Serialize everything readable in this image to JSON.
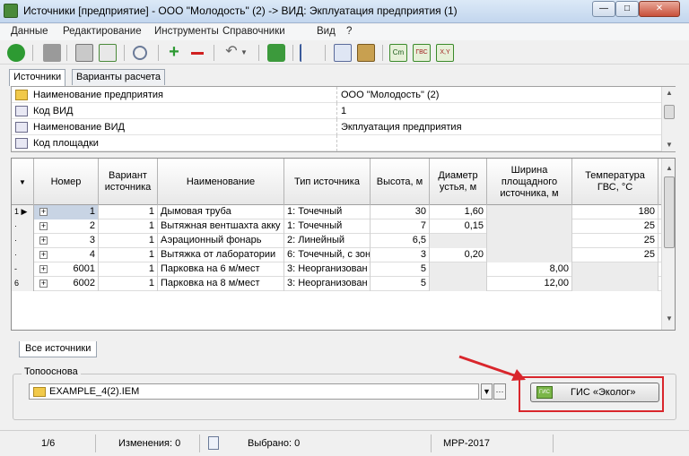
{
  "window": {
    "title": "Источники [предприятие] - ООО \"Молодость\" (2) -> ВИД: Экплуатация предприятия (1)"
  },
  "menu": [
    "Данные",
    "Редактирование",
    "Инструменты",
    "Справочники",
    "Вид",
    "?"
  ],
  "toolbar": {
    "items": [
      "back-icon",
      "save-icon",
      "print-icon",
      "export-icon",
      "search-icon",
      "add-icon",
      "remove-icon",
      "undo-icon",
      "refresh-icon",
      "tree-icon",
      "copy-icon",
      "paste-icon",
      "cm-icon",
      "gvs-icon",
      "xy-icon"
    ],
    "badges": {
      "cm": "Cm",
      "gvs": "ГВС",
      "xy": "X,Y"
    }
  },
  "tabs_top": [
    "Источники",
    "Варианты расчета"
  ],
  "properties": [
    {
      "name": "Наименование предприятия",
      "value": "ООО \"Молодость\" (2)",
      "icon": "folder-icon"
    },
    {
      "name": "Код ВИД",
      "value": "1",
      "icon": "field-icon"
    },
    {
      "name": "Наименование ВИД",
      "value": "Экплуатация предприятия",
      "icon": "field-icon"
    },
    {
      "name": "Код площадки",
      "value": "",
      "icon": "field-icon"
    }
  ],
  "grid": {
    "columns": [
      "Номер",
      "Вариант источника",
      "Наименование",
      "Тип источника",
      "Высота, м",
      "Диаметр устья, м",
      "Ширина площадного источника, м",
      "Температура ГВС, °С"
    ],
    "rows": [
      {
        "indicator": "1 ▶",
        "num": "1",
        "variant": "1",
        "name": "Дымовая труба",
        "type": "1: Точечный",
        "height": "30",
        "diam": "1,60",
        "width": "",
        "temp": "180"
      },
      {
        "indicator": "·",
        "num": "2",
        "variant": "1",
        "name": "Вытяжная вентшахта акку",
        "type": "1: Точечный",
        "height": "7",
        "diam": "0,15",
        "width": "",
        "temp": "25"
      },
      {
        "indicator": "·",
        "num": "3",
        "variant": "1",
        "name": "Аэрационный фонарь",
        "type": "2: Линейный",
        "height": "6,5",
        "diam": "",
        "width": "",
        "temp": "25"
      },
      {
        "indicator": "·",
        "num": "4",
        "variant": "1",
        "name": "Вытяжка от лаборатории",
        "type": "6: Точечный, с зон",
        "height": "3",
        "diam": "0,20",
        "width": "",
        "temp": "25"
      },
      {
        "indicator": "-",
        "num": "6001",
        "variant": "1",
        "name": "Парковка на 6 м/мест",
        "type": "3: Неорганизован",
        "height": "5",
        "diam": "",
        "width": "8,00",
        "temp": ""
      },
      {
        "indicator": "6",
        "num": "6002",
        "variant": "1",
        "name": "Парковка на 8 м/мест",
        "type": "3: Неорганизован",
        "height": "5",
        "diam": "",
        "width": "12,00",
        "temp": ""
      }
    ]
  },
  "bottom_tab": "Все источники",
  "toposnova": {
    "label": "Топооснова",
    "file": "EXAMPLE_4(2).IEM",
    "gis_button": "ГИС «Эколог»",
    "gis_badge": "ГИС"
  },
  "status": {
    "page": "1/6",
    "changes": "Изменения: 0",
    "selected": "Выбрано: 0",
    "method": "МРР-2017"
  },
  "colors": {
    "highlight": "#d9262c",
    "accent_green": "#3a9a2a"
  }
}
